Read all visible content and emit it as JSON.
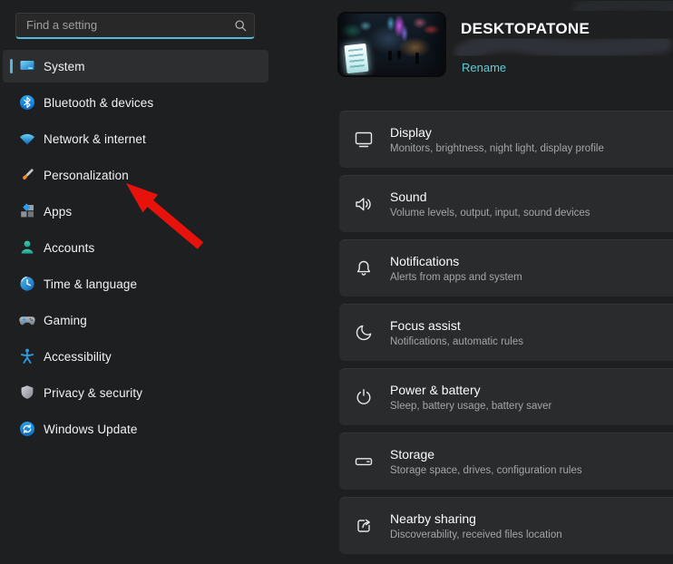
{
  "colors": {
    "accent_pill": "#58b4d9",
    "search_underline": "#56b7dc",
    "rename_link": "#60cbd7",
    "arrow_red": "#e8120c",
    "card_bg": "#2a2b2d",
    "background": "#1e1f20"
  },
  "search": {
    "placeholder": "Find a setting",
    "icon": "search-icon"
  },
  "sidebar": {
    "items": [
      {
        "label": "System",
        "icon": "system-icon",
        "selected": true
      },
      {
        "label": "Bluetooth & devices",
        "icon": "bluetooth-icon",
        "selected": false
      },
      {
        "label": "Network & internet",
        "icon": "network-icon",
        "selected": false
      },
      {
        "label": "Personalization",
        "icon": "personalization-icon",
        "selected": false
      },
      {
        "label": "Apps",
        "icon": "apps-icon",
        "selected": false
      },
      {
        "label": "Accounts",
        "icon": "accounts-icon",
        "selected": false
      },
      {
        "label": "Time & language",
        "icon": "time-language-icon",
        "selected": false
      },
      {
        "label": "Gaming",
        "icon": "gaming-icon",
        "selected": false
      },
      {
        "label": "Accessibility",
        "icon": "accessibility-icon",
        "selected": false
      },
      {
        "label": "Privacy & security",
        "icon": "privacy-security-icon",
        "selected": false
      },
      {
        "label": "Windows Update",
        "icon": "windows-update-icon",
        "selected": false
      }
    ]
  },
  "header": {
    "device_name": "DESKTOPATONE",
    "rename_label": "Rename",
    "thumbnail": "neon-alley-wallpaper-thumbnail",
    "redaction": "scribbled-out-text"
  },
  "cards": [
    {
      "title": "Display",
      "subtitle": "Monitors, brightness, night light, display profile",
      "icon": "display-icon"
    },
    {
      "title": "Sound",
      "subtitle": "Volume levels, output, input, sound devices",
      "icon": "sound-icon"
    },
    {
      "title": "Notifications",
      "subtitle": "Alerts from apps and system",
      "icon": "notifications-icon"
    },
    {
      "title": "Focus assist",
      "subtitle": "Notifications, automatic rules",
      "icon": "focus-assist-icon"
    },
    {
      "title": "Power & battery",
      "subtitle": "Sleep, battery usage, battery saver",
      "icon": "power-icon"
    },
    {
      "title": "Storage",
      "subtitle": "Storage space, drives, configuration rules",
      "icon": "storage-icon"
    },
    {
      "title": "Nearby sharing",
      "subtitle": "Discoverability, received files location",
      "icon": "nearby-sharing-icon"
    }
  ],
  "annotation": {
    "type": "red-arrow",
    "points_to": "Personalization"
  }
}
